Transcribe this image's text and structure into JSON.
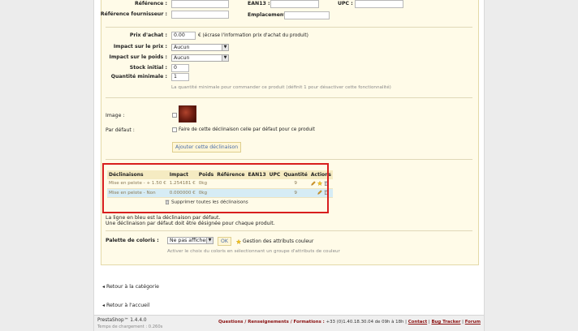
{
  "form": {
    "reference_label": "Référence :",
    "supplier_reference_label": "Référence fournisseur :",
    "ean13_label": "EAN13 :",
    "upc_label": "UPC :",
    "location_label": "Emplacement :",
    "purchase_price_label": "Prix d'achat :",
    "purchase_price_value": "0.00",
    "purchase_price_hint": "€ (écrase l'information prix d'achat du produit)",
    "price_impact_label": "Impact sur le prix :",
    "price_impact_value": "Aucun",
    "weight_impact_label": "Impact sur le poids :",
    "weight_impact_value": "Aucun",
    "initial_stock_label": "Stock initial :",
    "initial_stock_value": "0",
    "min_quantity_label": "Quantité minimale :",
    "min_quantity_value": "1",
    "min_quantity_hint": "La quantité minimale pour commander ce produit (définit 1 pour désactiver cette fonctionnalité)",
    "image_label": "Image :",
    "default_label": "Par défaut :",
    "default_checkbox_text": "Faire de cette déclinaison celle par défaut pour ce produit",
    "add_button": "Ajouter cette déclinaison"
  },
  "combinations": {
    "headers": [
      "Déclinaisons",
      "Impact",
      "Poids",
      "Référence",
      "EAN13",
      "UPC",
      "Quantité",
      "Actions"
    ],
    "rows": [
      {
        "name": "Mise en pelote - + 1.50 €",
        "impact": "1.254181 €",
        "weight": "0kg",
        "reference": "",
        "ean13": "",
        "upc": "",
        "quantity": "9",
        "default": false
      },
      {
        "name": "Mise en pelote - Non",
        "impact": "0.000000 €",
        "weight": "0kg",
        "reference": "",
        "ean13": "",
        "upc": "",
        "quantity": "9",
        "default": true
      }
    ],
    "delete_all": "Supprimer toutes les déclinaisons",
    "note_line1": "La ligne en bleu est la déclinaison par défaut.",
    "note_line2": "Une déclinaison par défaut doit être désignée pour chaque produit."
  },
  "palette": {
    "label": "Palette de coloris :",
    "select_value": "Ne pas afficher",
    "ok_button": "OK",
    "manage_link": "Gestion des attributs couleur",
    "hint": "Activer le choix du coloris en sélectionnant un groupe d'attributs de couleur"
  },
  "nav": {
    "back_category": "Retour à la catégorie",
    "back_home": "Retour à l'accueil"
  },
  "footer": {
    "version": "PrestaShop™ 1.4.4.0",
    "load_time": "Temps de chargement : 0.260s",
    "contact_prefix": "Questions / Renseignements / Formations :",
    "phone": "+33 (0)1.40.18.30.04 de 09h à 18h",
    "contact": "Contact",
    "bug_tracker": "Bug Tracker",
    "forum": "Forum"
  },
  "colors": {
    "highlight": "#d81e1e",
    "default_row": "#d6ecf5",
    "panel_bg": "#fffbe8"
  }
}
